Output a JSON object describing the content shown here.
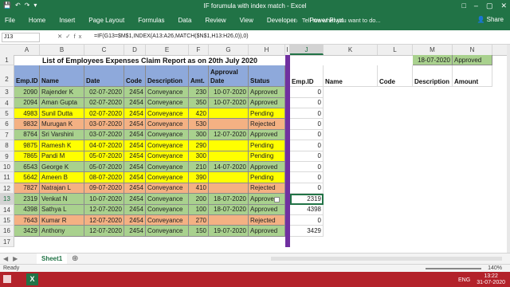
{
  "app": {
    "window_title": "IF forumula with index match - Excel",
    "qat_icons": [
      "save-icon",
      "undo-icon",
      "redo-icon",
      "customize-icon"
    ]
  },
  "ribbon": {
    "tabs": [
      "File",
      "Home",
      "Insert",
      "Page Layout",
      "Formulas",
      "Data",
      "Review",
      "View",
      "Developer",
      "Power Pivot"
    ],
    "tell_me": "Tell me what you want to do...",
    "share": "Share"
  },
  "formula_bar": {
    "name_box": "J13",
    "formula": "=IF(G13=$M$1,INDEX(A13:A26,MATCH($N$1,H13:H26,0)),0)"
  },
  "columns": [
    "A",
    "B",
    "C",
    "D",
    "E",
    "F",
    "G",
    "H",
    "I",
    "J",
    "K",
    "L",
    "M",
    "N"
  ],
  "rows": [
    "1",
    "2",
    "3",
    "4",
    "5",
    "6",
    "7",
    "8",
    "9",
    "10",
    "11",
    "12",
    "13",
    "14",
    "15",
    "16",
    "17"
  ],
  "sheet": {
    "title": "List of Employees Expenses Claim Report as on 20th July 2020",
    "criteria_date": "18-07-2020",
    "criteria_status": "Approved",
    "headers": [
      "Emp.ID",
      "Name",
      "Date",
      "Code",
      "Description",
      "Amt.",
      "Approval Date",
      "Status"
    ],
    "records": [
      {
        "id": "2090",
        "name": "Rajender K",
        "date": "02-07-2020",
        "code": "2454",
        "desc": "Conveyance",
        "amt": "230",
        "adate": "10-07-2020",
        "status": "Approved",
        "color": "#a9d18e"
      },
      {
        "id": "2094",
        "name": "Aman Gupta",
        "date": "02-07-2020",
        "code": "2454",
        "desc": "Conveyance",
        "amt": "350",
        "adate": "10-07-2020",
        "status": "Approved",
        "color": "#a9d18e"
      },
      {
        "id": "4983",
        "name": "Sunil Dutta",
        "date": "02-07-2020",
        "code": "2454",
        "desc": "Conveyance",
        "amt": "420",
        "adate": "",
        "status": "Pending",
        "color": "#ffff00"
      },
      {
        "id": "9832",
        "name": "Murugan K",
        "date": "03-07-2020",
        "code": "2454",
        "desc": "Conveyance",
        "amt": "530",
        "adate": "",
        "status": "Rejected",
        "color": "#f4b183"
      },
      {
        "id": "8764",
        "name": "Sri Varshini",
        "date": "03-07-2020",
        "code": "2454",
        "desc": "Conveyance",
        "amt": "300",
        "adate": "12-07-2020",
        "status": "Approved",
        "color": "#a9d18e"
      },
      {
        "id": "9875",
        "name": "Ramesh K",
        "date": "04-07-2020",
        "code": "2454",
        "desc": "Conveyance",
        "amt": "290",
        "adate": "",
        "status": "Pending",
        "color": "#ffff00"
      },
      {
        "id": "7865",
        "name": "Pandi M",
        "date": "05-07-2020",
        "code": "2454",
        "desc": "Conveyance",
        "amt": "300",
        "adate": "",
        "status": "Pending",
        "color": "#ffff00"
      },
      {
        "id": "6543",
        "name": "George K",
        "date": "05-07-2020",
        "code": "2454",
        "desc": "Conveyance",
        "amt": "210",
        "adate": "14-07-2020",
        "status": "Approved",
        "color": "#a9d18e"
      },
      {
        "id": "5642",
        "name": "Ameen B",
        "date": "08-07-2020",
        "code": "2454",
        "desc": "Conveyance",
        "amt": "390",
        "adate": "",
        "status": "Pending",
        "color": "#ffff00"
      },
      {
        "id": "7827",
        "name": "Natrajan L",
        "date": "09-07-2020",
        "code": "2454",
        "desc": "Conveyance",
        "amt": "410",
        "adate": "",
        "status": "Rejected",
        "color": "#f4b183"
      },
      {
        "id": "2319",
        "name": "Venkat N",
        "date": "10-07-2020",
        "code": "2454",
        "desc": "Conveyance",
        "amt": "200",
        "adate": "18-07-2020",
        "status": "Approve",
        "color": "#a9d18e"
      },
      {
        "id": "4398",
        "name": "Sathya L",
        "date": "12-07-2020",
        "code": "2454",
        "desc": "Conveyance",
        "amt": "100",
        "adate": "18-07-2020",
        "status": "Approved",
        "color": "#a9d18e"
      },
      {
        "id": "7643",
        "name": "Kumar R",
        "date": "12-07-2020",
        "code": "2454",
        "desc": "Conveyance",
        "amt": "270",
        "adate": "",
        "status": "Rejected",
        "color": "#f4b183"
      },
      {
        "id": "3429",
        "name": "Anthony",
        "date": "12-07-2020",
        "code": "2454",
        "desc": "Conveyance",
        "amt": "150",
        "adate": "19-07-2020",
        "status": "Approved",
        "color": "#a9d18e"
      }
    ],
    "result_headers": [
      "Emp.ID",
      "Name",
      "Code",
      "Description",
      "Amount"
    ],
    "result_ids": [
      "0",
      "0",
      "0",
      "0",
      "0",
      "0",
      "0",
      "0",
      "0",
      "0",
      "2319",
      "4398",
      "0",
      "3429"
    ]
  },
  "sheet_tabs": [
    "Sheet1"
  ],
  "status": {
    "ready": "Ready",
    "zoom": "140%"
  },
  "taskbar": {
    "lang": "ENG",
    "time": "13:22",
    "date": "31-07-2020"
  },
  "colors": {
    "excel_green": "#217346",
    "header_blue": "#8ea9db",
    "approved": "#a9d18e",
    "pending": "#ffff00",
    "rejected": "#f4b183",
    "divider": "#7030a0",
    "criteria": "#a9d18e"
  }
}
